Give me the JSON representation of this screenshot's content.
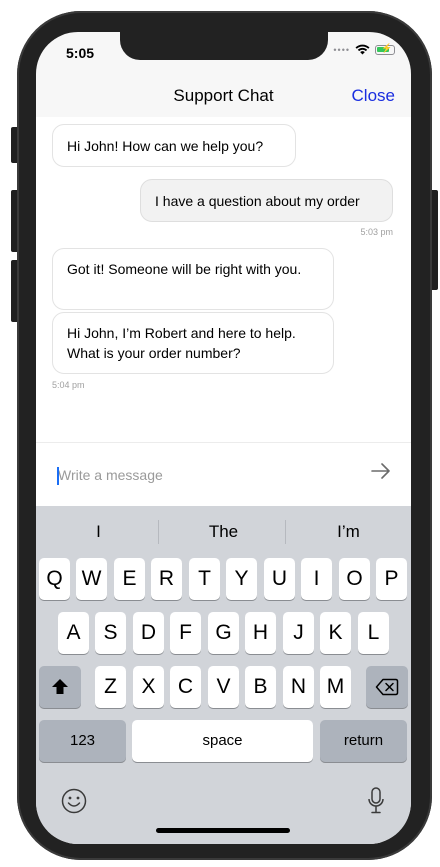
{
  "status": {
    "time": "5:05"
  },
  "nav": {
    "title": "Support Chat",
    "close_label": "Close"
  },
  "messages": [
    {
      "text": "Hi John! How can we help you?",
      "direction": "in"
    },
    {
      "text": "I have a question about my order",
      "direction": "out",
      "time": "5:03 pm"
    },
    {
      "text": "Got it! Someone will be right with you.",
      "direction": "in"
    },
    {
      "text": "Hi John, I’m Robert and here to help. What is your order number?",
      "direction": "in",
      "time": "5:04 pm"
    }
  ],
  "composer": {
    "placeholder": "Write a message"
  },
  "keyboard": {
    "predictions": [
      "I",
      "The",
      "I’m"
    ],
    "row1": [
      "Q",
      "W",
      "E",
      "R",
      "T",
      "Y",
      "U",
      "I",
      "O",
      "P"
    ],
    "row2": [
      "A",
      "S",
      "D",
      "F",
      "G",
      "H",
      "J",
      "K",
      "L"
    ],
    "row3": [
      "Z",
      "X",
      "C",
      "V",
      "B",
      "N",
      "M"
    ],
    "numbers_label": "123",
    "space_label": "space",
    "return_label": "return"
  },
  "colors": {
    "accent": "#1a2ee0",
    "keyboard_bg": "#d1d4d9",
    "battery": "#34c759"
  }
}
